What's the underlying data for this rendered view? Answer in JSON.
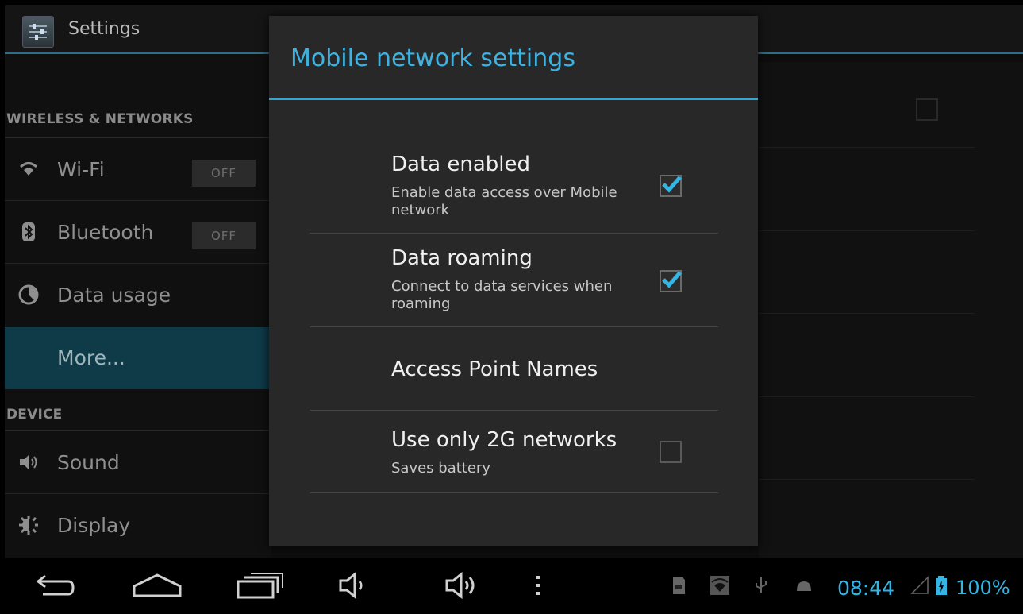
{
  "app": {
    "title": "Settings"
  },
  "left_panel": {
    "sections": [
      {
        "header": "WIRELESS & NETWORKS"
      },
      {
        "header": "DEVICE"
      }
    ],
    "items": [
      {
        "label": "Wi-Fi",
        "icon": "wifi-icon",
        "toggle": "OFF"
      },
      {
        "label": "Bluetooth",
        "icon": "bluetooth-icon",
        "toggle": "OFF"
      },
      {
        "label": "Data usage",
        "icon": "data-usage-icon"
      },
      {
        "label": "More...",
        "selected": true
      },
      {
        "label": "Sound",
        "icon": "speaker-icon"
      },
      {
        "label": "Display",
        "icon": "display-icon"
      }
    ]
  },
  "dialog": {
    "title": "Mobile network settings",
    "prefs": [
      {
        "title": "Data enabled",
        "summary": "Enable data access over Mobile network",
        "checked": true
      },
      {
        "title": "Data roaming",
        "summary": "Connect to data services when roaming",
        "checked": true
      },
      {
        "title": "Access Point Names"
      },
      {
        "title": "Use only 2G networks",
        "summary": "Saves battery",
        "checked": false
      }
    ]
  },
  "navbar": {
    "buttons": [
      "back-icon",
      "home-icon",
      "recent-apps-icon",
      "volume-down-icon",
      "volume-up-icon",
      "menu-icon"
    ],
    "status_icons": [
      "sd-card-icon",
      "wifi-status-icon",
      "usb-icon",
      "android-debug-icon",
      "signal-icon",
      "battery-icon"
    ],
    "clock": "08:44",
    "battery": "100%"
  },
  "colors": {
    "accent": "#33b5e5",
    "selected_bg": "#0f3a48"
  }
}
